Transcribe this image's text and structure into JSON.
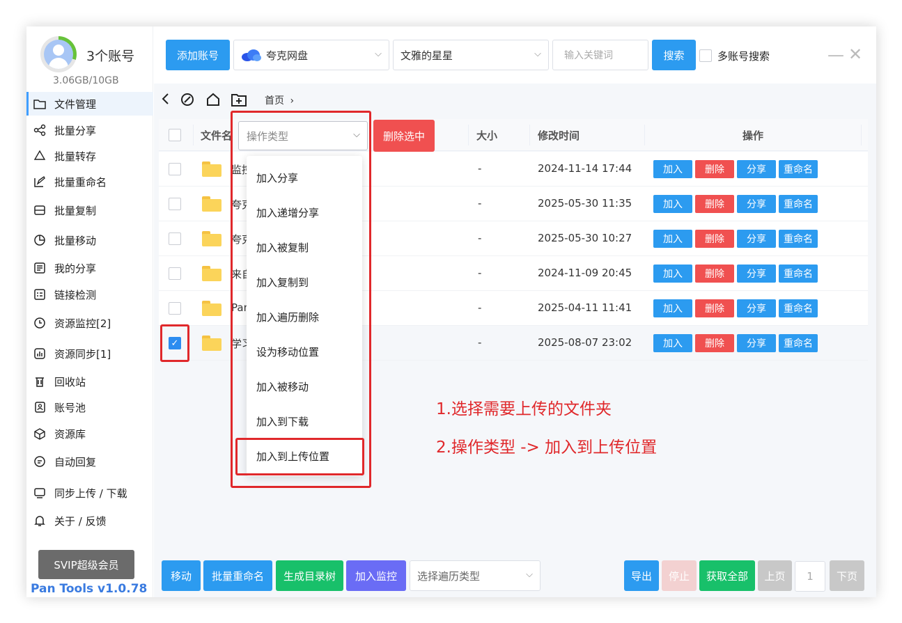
{
  "account": {
    "count_label": "3个账号",
    "storage": "3.06GB/10GB"
  },
  "sidebar": {
    "items": [
      {
        "label": "文件管理",
        "icon": "folder-icon"
      },
      {
        "label": "批量分享",
        "icon": "share-icon"
      },
      {
        "label": "批量转存",
        "icon": "recycle-icon"
      },
      {
        "label": "批量重命名",
        "icon": "edit-icon"
      },
      {
        "label": "批量复制",
        "icon": "copy-icon"
      },
      {
        "label": "批量移动",
        "icon": "move-icon"
      },
      {
        "label": "我的分享",
        "icon": "doc-icon"
      },
      {
        "label": "链接检测",
        "icon": "checklist-icon"
      },
      {
        "label": "资源监控[2]",
        "icon": "clock-icon"
      },
      {
        "label": "资源同步[1]",
        "icon": "chart-icon"
      },
      {
        "label": "回收站",
        "icon": "trash-icon"
      },
      {
        "label": "账号池",
        "icon": "contact-icon"
      },
      {
        "label": "资源库",
        "icon": "box-icon"
      },
      {
        "label": "自动回复",
        "icon": "reply-icon"
      },
      {
        "label": "同步上传 / 下载",
        "icon": "monitor-icon"
      },
      {
        "label": "关于 / 反馈",
        "icon": "bell-icon"
      }
    ],
    "svip_label": "SVIP超级会员",
    "version": "Pan Tools v1.0.78"
  },
  "topbar": {
    "add_account": "添加账号",
    "drive_select": "夸克网盘",
    "account_select": "文雅的星星",
    "search_placeholder": "输入关键词",
    "search_button": "搜索",
    "multi_search_label": "多账号搜索"
  },
  "breadcrumb": {
    "home": "首页",
    "sep": "›"
  },
  "table": {
    "headers": {
      "name": "文件名",
      "size": "大小",
      "mtime": "修改时间",
      "ops": "操作"
    },
    "delete_selected": "删除选中",
    "op_labels": {
      "add": "加入",
      "delete": "删除",
      "share": "分享",
      "rename": "重命名"
    },
    "rows": [
      {
        "name": "监控",
        "size": "-",
        "mtime": "2024-11-14 17:44",
        "checked": false
      },
      {
        "name": "夸克",
        "size": "-",
        "mtime": "2025-05-30 11:35",
        "checked": false
      },
      {
        "name": "夸克",
        "size": "-",
        "mtime": "2025-05-30 10:27",
        "checked": false
      },
      {
        "name": "来自",
        "size": "-",
        "mtime": "2024-11-09 20:45",
        "checked": false
      },
      {
        "name": "Pan",
        "size": "-",
        "mtime": "2025-04-11 11:41",
        "checked": false
      },
      {
        "name": "学习",
        "size": "-",
        "mtime": "2025-08-07 23:02",
        "checked": true
      }
    ]
  },
  "op_type": {
    "placeholder": "操作类型",
    "options": [
      "加入分享",
      "加入递增分享",
      "加入被复制",
      "加入复制到",
      "加入遍历删除",
      "设为移动位置",
      "加入被移动",
      "加入到下载",
      "加入到上传位置"
    ]
  },
  "annotations": {
    "step1": "1.选择需要上传的文件夹",
    "step2": "2.操作类型 -> 加入到上传位置"
  },
  "bottom": {
    "move": "移动",
    "batch_rename": "批量重命名",
    "gen_tree": "生成目录树",
    "add_monitor": "加入监控",
    "traverse_placeholder": "选择遍历类型",
    "export": "导出",
    "stop": "停止",
    "fetch_all": "获取全部",
    "prev": "上页",
    "page": "1",
    "next": "下页"
  },
  "colors": {
    "primary": "#2c9bf0",
    "danger": "#f05050",
    "success": "#18c06a",
    "purple": "#6a6cf5",
    "highlight": "#e0282b"
  }
}
